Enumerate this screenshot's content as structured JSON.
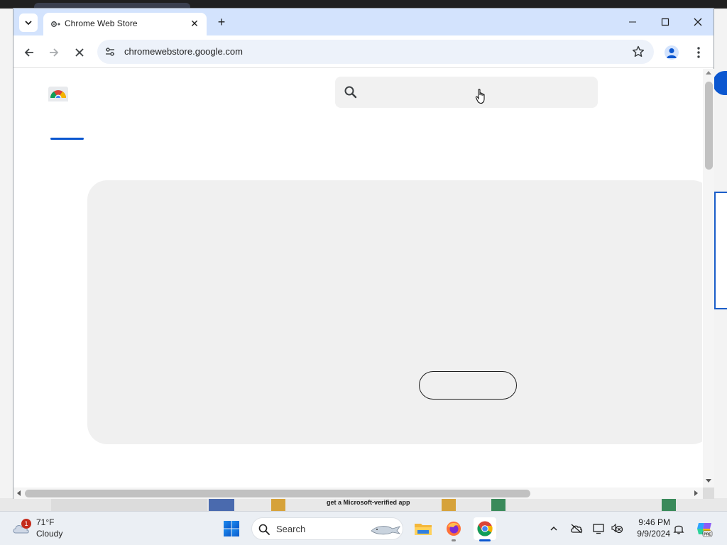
{
  "browser": {
    "tab_title": "Chrome Web Store",
    "url": "chromewebstore.google.com",
    "tab_close_glyph": "✕",
    "new_tab_glyph": "+"
  },
  "page": {
    "search_placeholder": "",
    "hero_button_label": ""
  },
  "background_window": {
    "strip_text": "get a Microsoft-verified app"
  },
  "taskbar": {
    "weather_temp": "71°F",
    "weather_condition": "Cloudy",
    "weather_badge": "1",
    "search_label": "Search",
    "time": "9:46 PM",
    "date": "9/9/2024",
    "apps": [
      "file-explorer-icon",
      "firefox-icon",
      "chrome-icon"
    ]
  },
  "colors": {
    "accent": "#0b57d0",
    "titlebar": "#d3e3fd",
    "omnibox": "#edf2fa",
    "hero_bg": "#f0f0f0"
  }
}
